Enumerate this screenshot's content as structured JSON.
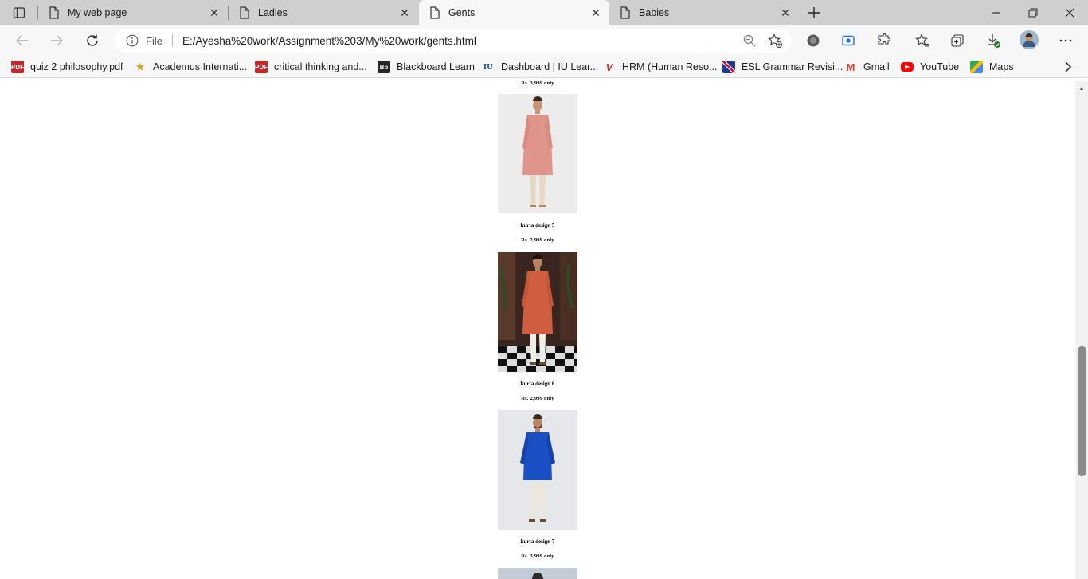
{
  "tabs": [
    {
      "title": "My web page",
      "active": false
    },
    {
      "title": "Ladies",
      "active": false
    },
    {
      "title": "Gents",
      "active": true
    },
    {
      "title": "Babies",
      "active": false
    }
  ],
  "omnibox": {
    "protocol_label": "File",
    "url": "E:/Ayesha%20work/Assignment%203/My%20work/gents.html"
  },
  "bookmarks": [
    {
      "label": "quiz 2 philosophy.pdf",
      "icon": "pdf-icon",
      "badge": "PDF",
      "color": "#c62828"
    },
    {
      "label": "Academus Internati...",
      "icon": "academus-icon",
      "badge": "",
      "color": "#d4a017"
    },
    {
      "label": "critical thinking and...",
      "icon": "pdf-icon",
      "badge": "PDF",
      "color": "#c62828"
    },
    {
      "label": "Blackboard Learn",
      "icon": "blackboard-icon",
      "badge": "Bb",
      "color": "#262626"
    },
    {
      "label": "Dashboard | IU Lear...",
      "icon": "iu-icon",
      "badge": "IU",
      "color": "#1a4fa0"
    },
    {
      "label": "HRM (Human Reso...",
      "icon": "vu-icon",
      "badge": "V",
      "color": "#d32f2f"
    },
    {
      "label": "ESL Grammar Revisi...",
      "icon": "uk-flag-icon",
      "badge": "",
      "color": "#1f3a93"
    },
    {
      "label": "Gmail",
      "icon": "gmail-icon",
      "badge": "M",
      "color": "#ea4335"
    },
    {
      "label": "YouTube",
      "icon": "youtube-icon",
      "badge": "▶",
      "color": "#ff0000"
    },
    {
      "label": "Maps",
      "icon": "maps-icon",
      "badge": "",
      "color": "#34a853"
    }
  ],
  "page": {
    "top_price": "Rs. 3,999 only",
    "products": [
      {
        "name": "kurta design 5",
        "price": "Rs. 2,999 only",
        "image": "pink-kurta-photo"
      },
      {
        "name": "kurta design 6",
        "price": "Rs. 2,999 only",
        "image": "orange-kurta-photo"
      },
      {
        "name": "kurta design 7",
        "price": "Rs. 3,999 only",
        "image": "blue-kurta-photo"
      }
    ]
  },
  "colors": {
    "tab_strip": "#cfcfcf",
    "toolbar": "#f7f7f7",
    "pink_kurta": "#e0958a",
    "orange_kurta": "#cf5f40",
    "blue_kurta": "#1b4fc4"
  },
  "scroll": {
    "thumb_position": 0.55,
    "thumb_size": 0.26
  }
}
